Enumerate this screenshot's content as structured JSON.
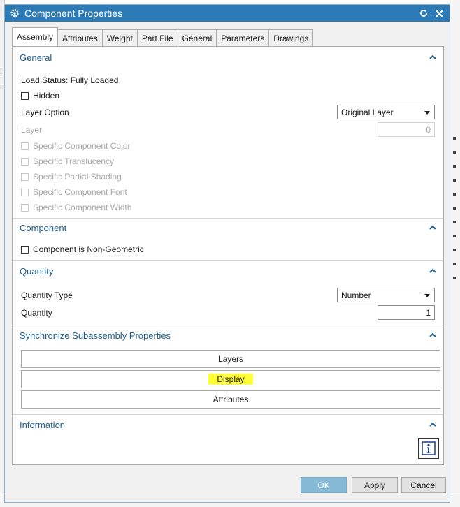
{
  "window": {
    "title": "Component Properties"
  },
  "tabs": [
    {
      "label": "Assembly",
      "active": true
    },
    {
      "label": "Attributes"
    },
    {
      "label": "Weight"
    },
    {
      "label": "Part File"
    },
    {
      "label": "General"
    },
    {
      "label": "Parameters"
    },
    {
      "label": "Drawings"
    }
  ],
  "general": {
    "header": "General",
    "load_status": "Load Status: Fully Loaded",
    "hidden_label": "Hidden",
    "layer_option_label": "Layer Option",
    "layer_option_value": "Original Layer",
    "layer_label": "Layer",
    "layer_value": "0",
    "disabled_options": [
      "Specific Component Color",
      "Specific Translucency",
      "Specific Partial Shading",
      "Specific Component Font",
      "Specific Component Width"
    ]
  },
  "component": {
    "header": "Component",
    "non_geometric_label": "Component is Non-Geometric"
  },
  "quantity": {
    "header": "Quantity",
    "type_label": "Quantity Type",
    "type_value": "Number",
    "quantity_label": "Quantity",
    "quantity_value": "1"
  },
  "sync": {
    "header": "Synchronize Subassembly Properties",
    "buttons": [
      "Layers",
      "Display",
      "Attributes"
    ]
  },
  "information": {
    "header": "Information"
  },
  "footer": {
    "ok": "OK",
    "apply": "Apply",
    "cancel": "Cancel"
  },
  "colors": {
    "titlebar": "#2b79b5",
    "section_header": "#1f5f8f",
    "highlight": "#ffff33",
    "ok_button": "#86b9d6"
  }
}
